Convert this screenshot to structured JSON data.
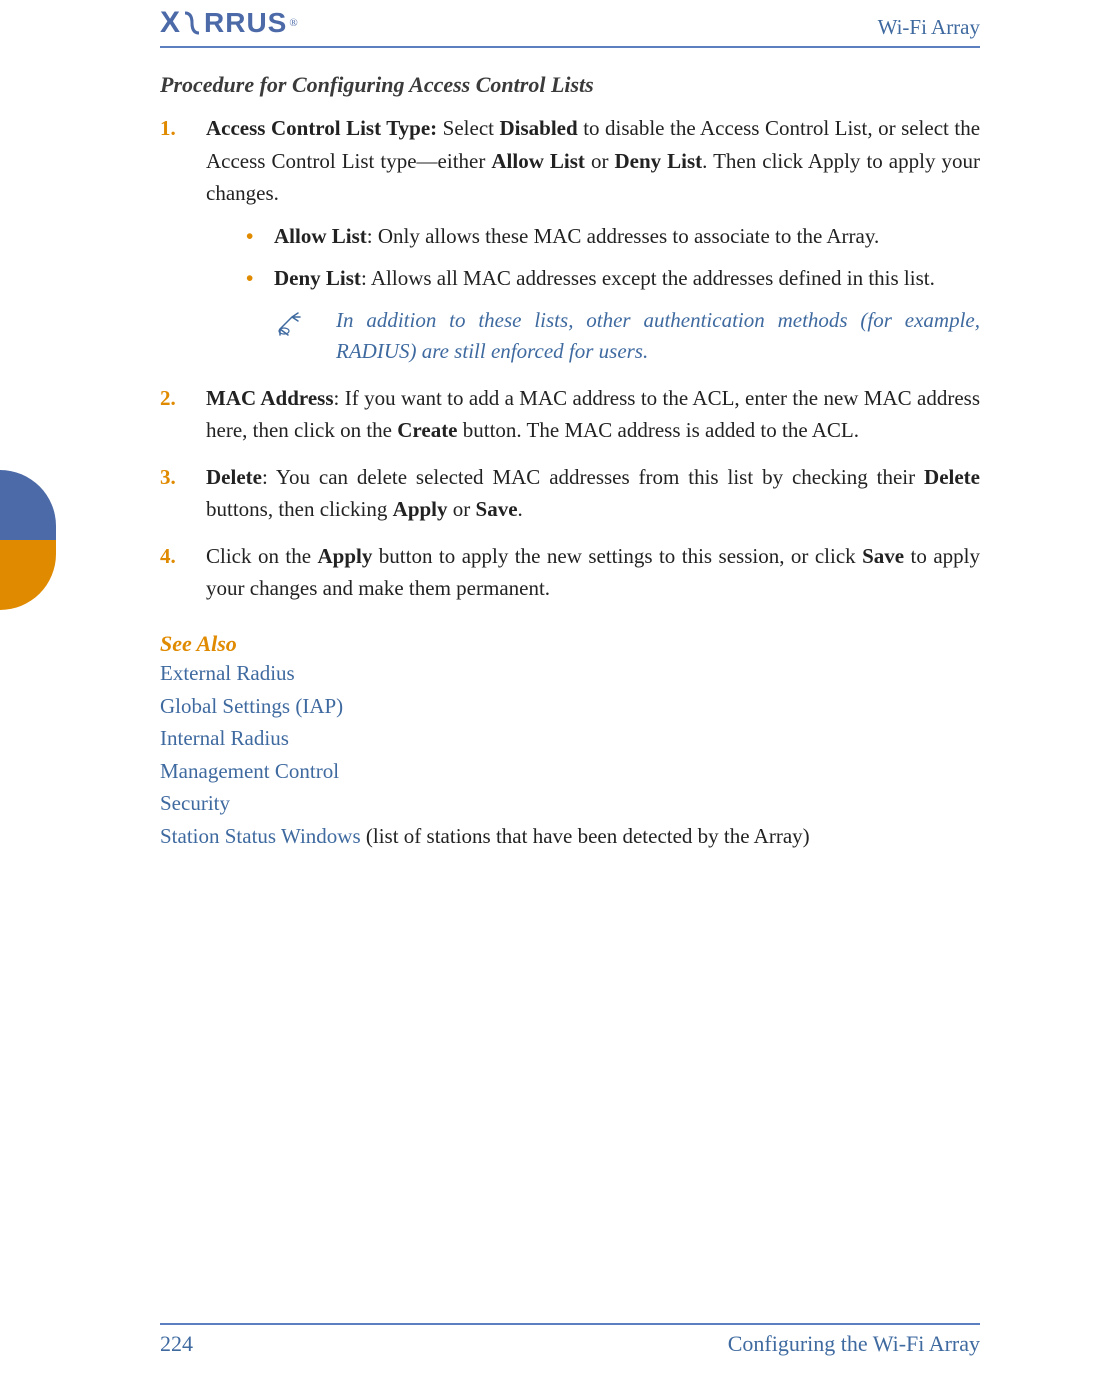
{
  "header": {
    "logo_text_left": "X",
    "logo_text_right": "RRUS",
    "logo_reg": "®",
    "right_label": "Wi-Fi Array"
  },
  "title": "Procedure for Configuring Access Control Lists",
  "steps": {
    "s1": {
      "num": "1.",
      "lead": "Access Control List Type:",
      "rest_a": " Select ",
      "b1": "Disabled",
      "rest_b": " to disable the Access Control List, or select the Access Control List type—either ",
      "b2": "Allow List",
      "rest_c": " or ",
      "b3": "Deny List",
      "rest_d": ". Then click Apply to apply your changes."
    },
    "sub_allow": {
      "b": "Allow List",
      "rest": ": Only allows these MAC addresses to associate to the Array."
    },
    "sub_deny": {
      "b": "Deny List",
      "rest": ": Allows all MAC addresses except the addresses defined in this list."
    },
    "note": "In addition to these lists, other authentication methods (for example, RADIUS) are still enforced for users.",
    "s2": {
      "num": "2.",
      "lead": "MAC Address",
      "rest_a": ": If you want to add a MAC address to the ACL, enter the new MAC address here, then click on the ",
      "b1": "Create",
      "rest_b": " button. The MAC address is added to the ACL."
    },
    "s3": {
      "num": "3.",
      "lead": "Delete",
      "rest_a": ": You can delete selected MAC addresses from this list by checking their ",
      "b1": "Delete",
      "rest_b": " buttons, then clicking ",
      "b2": "Apply",
      "rest_c": " or ",
      "b3": "Save",
      "rest_d": "."
    },
    "s4": {
      "num": "4.",
      "rest_a": "Click on the ",
      "b1": "Apply",
      "rest_b": " button to apply the new settings to this session, or click ",
      "b2": "Save",
      "rest_c": " to apply your changes and make them permanent."
    }
  },
  "see_also": {
    "heading": "See Also",
    "items": {
      "l1": "External Radius",
      "l2": "Global Settings (IAP)",
      "l3": "Internal Radius",
      "l4": "Management Control",
      "l5": "Security",
      "l6_link": "Station Status Windows",
      "l6_tail": " (list of stations that have been detected by the Array)"
    }
  },
  "footer": {
    "page": "224",
    "section": "Configuring the Wi-Fi Array"
  }
}
